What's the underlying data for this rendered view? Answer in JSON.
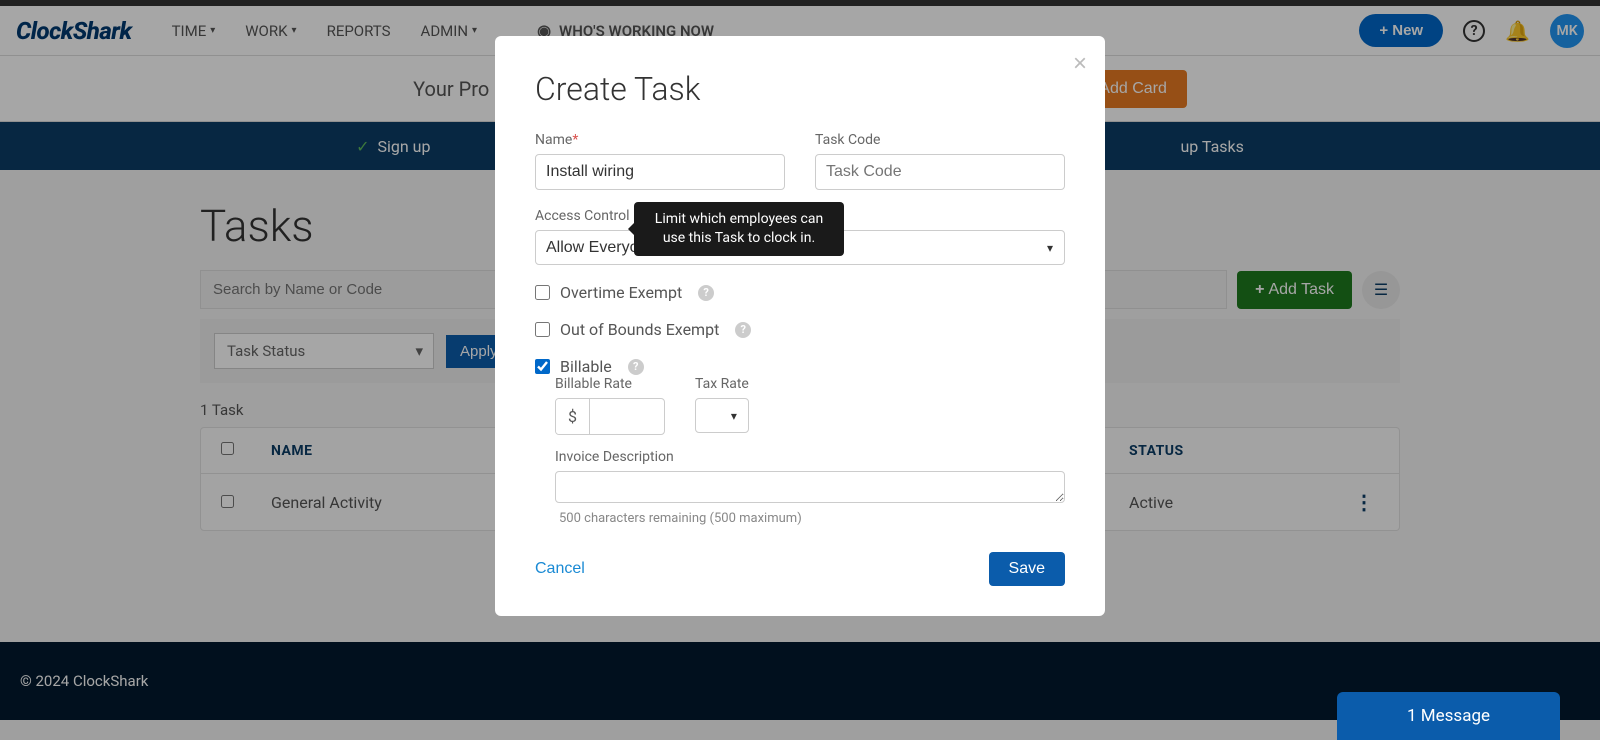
{
  "brand": "ClockShark",
  "nav": {
    "time": "TIME",
    "work": "WORK",
    "reports": "REPORTS",
    "admin": "ADMIN",
    "working_now": "WHO'S WORKING NOW"
  },
  "header_actions": {
    "new": "+ New",
    "avatar": "MK"
  },
  "sub_banner": {
    "text": "Your Pro",
    "button": "Add Card"
  },
  "progress": {
    "signup": "Sign up",
    "tasks": "up Tasks"
  },
  "page": {
    "title": "Tasks",
    "search_placeholder": "Search by Name or Code",
    "add_task": "Add Task",
    "task_status": "Task Status",
    "apply": "Apply",
    "count": "1 Task"
  },
  "table": {
    "headers": {
      "name": "NAME",
      "status": "STATUS"
    },
    "rows": [
      {
        "name": "General Activity",
        "status": "Active"
      }
    ]
  },
  "modal": {
    "title": "Create Task",
    "name_label": "Name",
    "name_value": "Install wiring",
    "task_code_label": "Task Code",
    "task_code_placeholder": "Task Code",
    "access_control_label": "Access Control",
    "access_control_value": "Allow Everyone",
    "overtime_label": "Overtime Exempt",
    "oob_label": "Out of Bounds Exempt",
    "billable_label": "Billable",
    "billable_rate_label": "Billable Rate",
    "rate_prefix": "$",
    "tax_rate_label": "Tax Rate",
    "invoice_label": "Invoice Description",
    "char_hint": "500 characters remaining (500 maximum)",
    "cancel": "Cancel",
    "save": "Save"
  },
  "tooltip_text": "Limit which employees can use this Task to clock in.",
  "footer": "© 2024 ClockShark",
  "message_count": "1 Message"
}
